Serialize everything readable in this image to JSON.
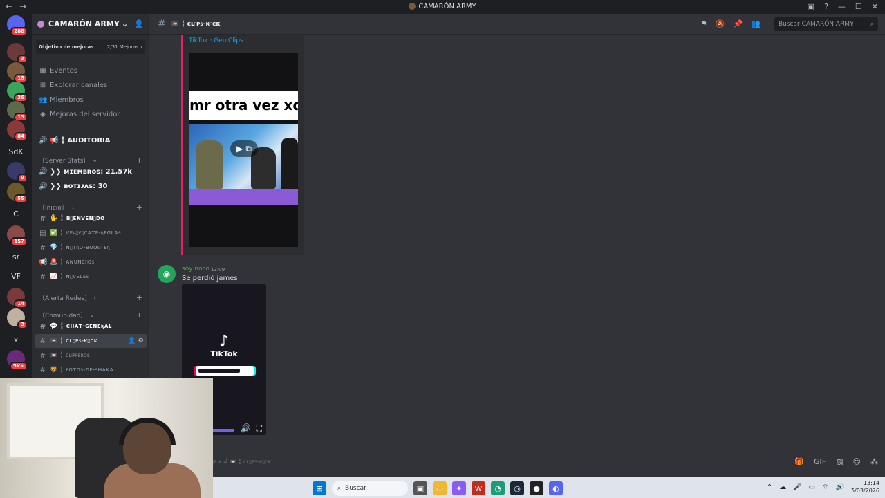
{
  "window": {
    "title": "CAMARÓN ARMY",
    "back": "←",
    "forward": "→"
  },
  "server_rail": [
    {
      "label": "",
      "badge": "286",
      "color": "#5865f2",
      "y": 0
    },
    {
      "label": "",
      "badge": "3",
      "color": "#6b3a3a"
    },
    {
      "label": "",
      "badge": "18",
      "color": "#7a5a3a"
    },
    {
      "label": "",
      "badge": "36",
      "color": "#3ba55c"
    },
    {
      "label": "",
      "badge": "13",
      "color": "#5a6a4a"
    },
    {
      "label": "",
      "badge": "84",
      "color": "#8a3a3a"
    },
    {
      "label": "SdK",
      "badge": "",
      "color": ""
    },
    {
      "label": "",
      "badge": "9",
      "color": "#3a3a6a"
    },
    {
      "label": "",
      "badge": "55",
      "color": "#6a5a2a"
    },
    {
      "label": "C",
      "badge": "",
      "color": ""
    },
    {
      "label": "",
      "badge": "157",
      "color": "#8a4a4a"
    },
    {
      "label": "sr",
      "badge": "",
      "color": ""
    },
    {
      "label": "VF",
      "badge": "",
      "color": ""
    },
    {
      "label": "",
      "badge": "14",
      "color": "#7a3a3a"
    },
    {
      "label": "",
      "badge": "3",
      "color": "#c0b0a0"
    },
    {
      "label": "x",
      "badge": "",
      "color": ""
    },
    {
      "label": "",
      "badge": "5K+",
      "color": "#6a2a7a"
    }
  ],
  "guild": {
    "name": "CAMARÓN ARMY",
    "chevron": "⌄"
  },
  "boost": {
    "label": "Objetivo de mejoras",
    "count": "2/31 Mejoras",
    "arrow": "›"
  },
  "menu": [
    {
      "icon": "▦",
      "label": "Eventos"
    },
    {
      "icon": "⊞",
      "label": "Explorar canales"
    },
    {
      "icon": "👥",
      "label": "Miembros"
    },
    {
      "icon": "◈",
      "label": "Mejoras del servidor"
    }
  ],
  "auditoria": {
    "label": "📢 ╏ AUDITORIA"
  },
  "categories": {
    "server_stats": "〔Server Stats〕",
    "inicio": "〔Inicio〕",
    "alerta": "〔Alerta Redes〕",
    "comunidad": "〔Comunidad〕"
  },
  "stats": [
    "❯❯ ᴍɪᴇᴍʙʀᴏs: 21.57k",
    "❯❯ ʙᴏᴛɪᴊᴀs: 30"
  ],
  "inicio_channels": [
    {
      "icon": "#",
      "label": "🖐 ╏ ʙɪᴇɴᴠᴇɴɪᴅᴏ",
      "bold": true
    },
    {
      "icon": "▤",
      "label": "✅ ╏ ᴠᴇʀɪғɪᴄᴀᴛᴇ-ʀᴇɢʟᴀs"
    },
    {
      "icon": "#",
      "label": "💎 ╏ ɴɪᴛʀᴏ-ʙᴏᴏsᴛᴇʀ"
    },
    {
      "icon": "📢",
      "label": "🚨 ╏ ᴀɴᴜɴᴄɪᴏs"
    },
    {
      "icon": "#",
      "label": "📈 ╏ ɴɪᴠᴇʟᴇs"
    }
  ],
  "comunidad_channels": [
    {
      "icon": "#",
      "label": "💬 ╏ ᴄʜᴀᴛ-ɢᴇɴᴇʀᴀʟ",
      "bold": true
    },
    {
      "icon": "#",
      "label": "📼 ╏ ᴄʟɪᴘs-ᴋɪᴄᴋ",
      "active": true
    },
    {
      "icon": "#",
      "label": "📼 ╏ clipperos"
    },
    {
      "icon": "#",
      "label": "🦁 ╏ ғᴏᴛᴏs-ᴅᴇ-sʜᴀᴋᴀ"
    }
  ],
  "header": {
    "channel": "📼 ╏ ᴄʟɪᴘs-ᴋɪᴄᴋ",
    "search_placeholder": "Buscar CAMARÓN ARMY"
  },
  "embed": {
    "provider": "TikTok · GeulClips",
    "caption": "mr otra vez xd"
  },
  "message": {
    "user": "soy ñoco",
    "time": "13:09",
    "text": "Se perdió james"
  },
  "tiktok": {
    "logo": "♪",
    "name": "TikTok"
  },
  "composer": {
    "placeholder": "saje a # 📼 ╏ ᴄʟɪᴘs-ᴋɪᴄᴋ"
  },
  "taskbar": {
    "search": "Buscar",
    "time": "13:14",
    "date": "5/03/2026"
  }
}
